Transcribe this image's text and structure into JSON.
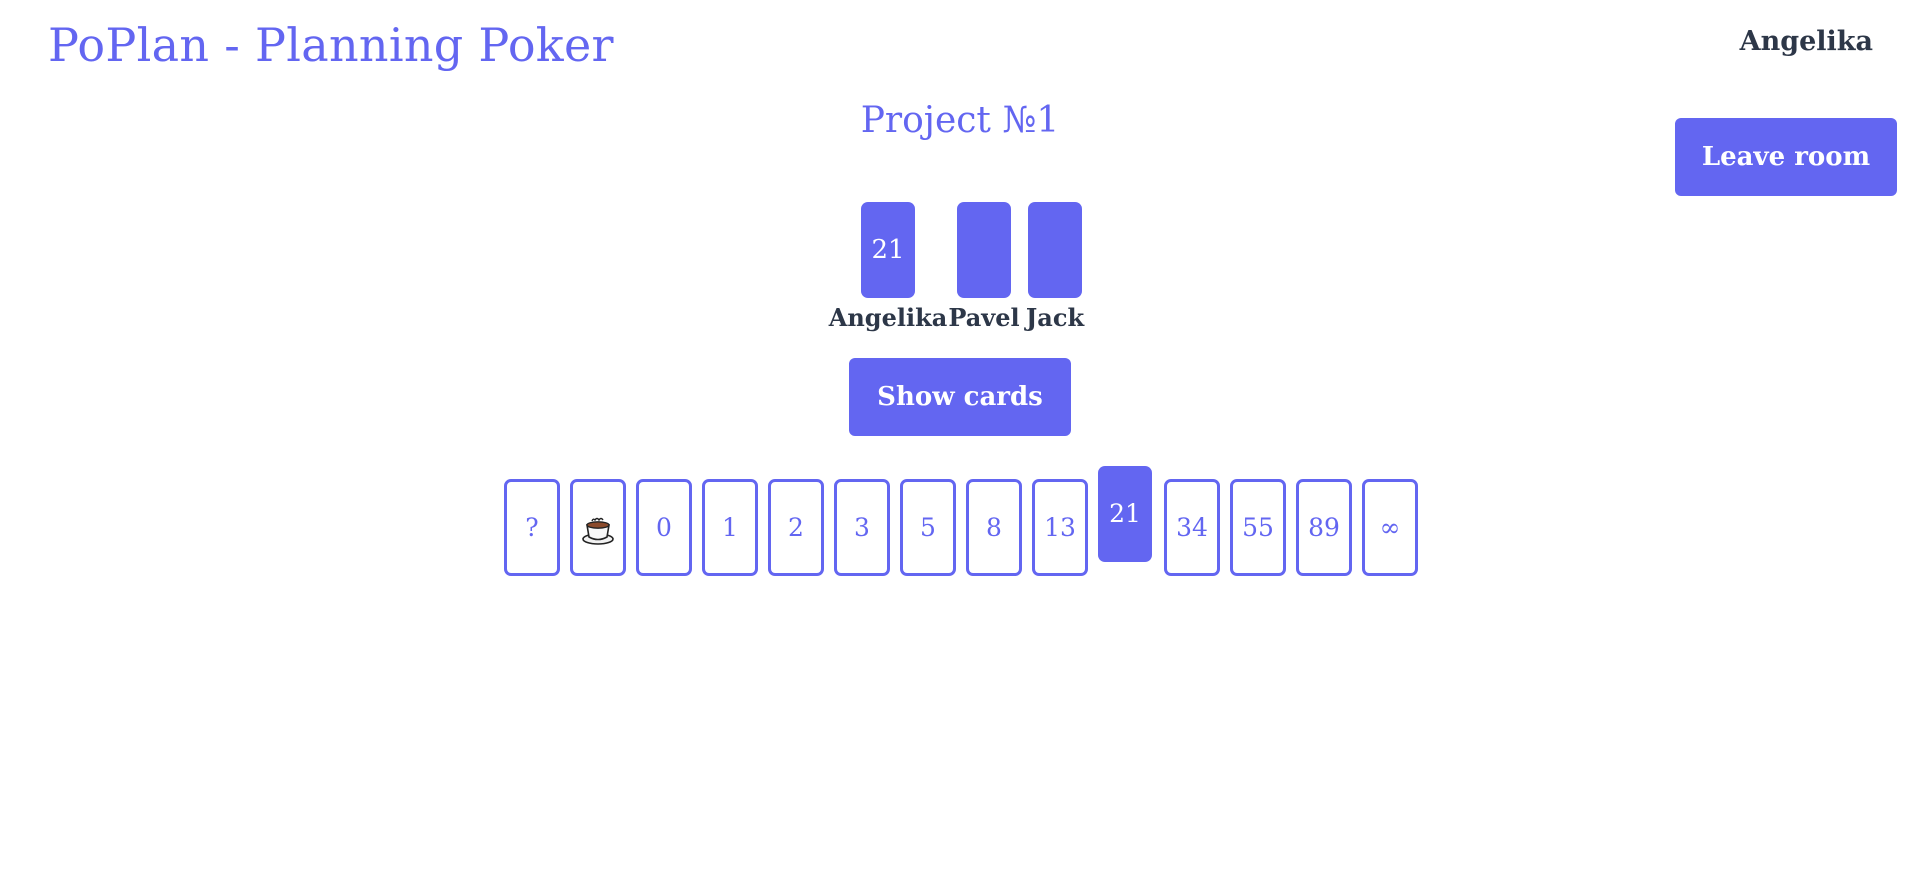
{
  "header": {
    "app_title": "PoPlan - Planning Poker",
    "current_user": "Angelika",
    "leave_label": "Leave room"
  },
  "room": {
    "title": "Project №1"
  },
  "players": [
    {
      "name": "Angelika",
      "card": "21"
    },
    {
      "name": "Pavel",
      "card": ""
    },
    {
      "name": "Jack",
      "card": ""
    }
  ],
  "actions": {
    "show_cards_label": "Show cards"
  },
  "deck": {
    "cards": [
      "?",
      "coffee",
      "0",
      "1",
      "2",
      "3",
      "5",
      "8",
      "13",
      "21",
      "34",
      "55",
      "89",
      "∞"
    ],
    "selected": "21"
  },
  "colors": {
    "accent": "#6366f1",
    "text_dark": "#2d3748",
    "background": "#ffffff"
  }
}
